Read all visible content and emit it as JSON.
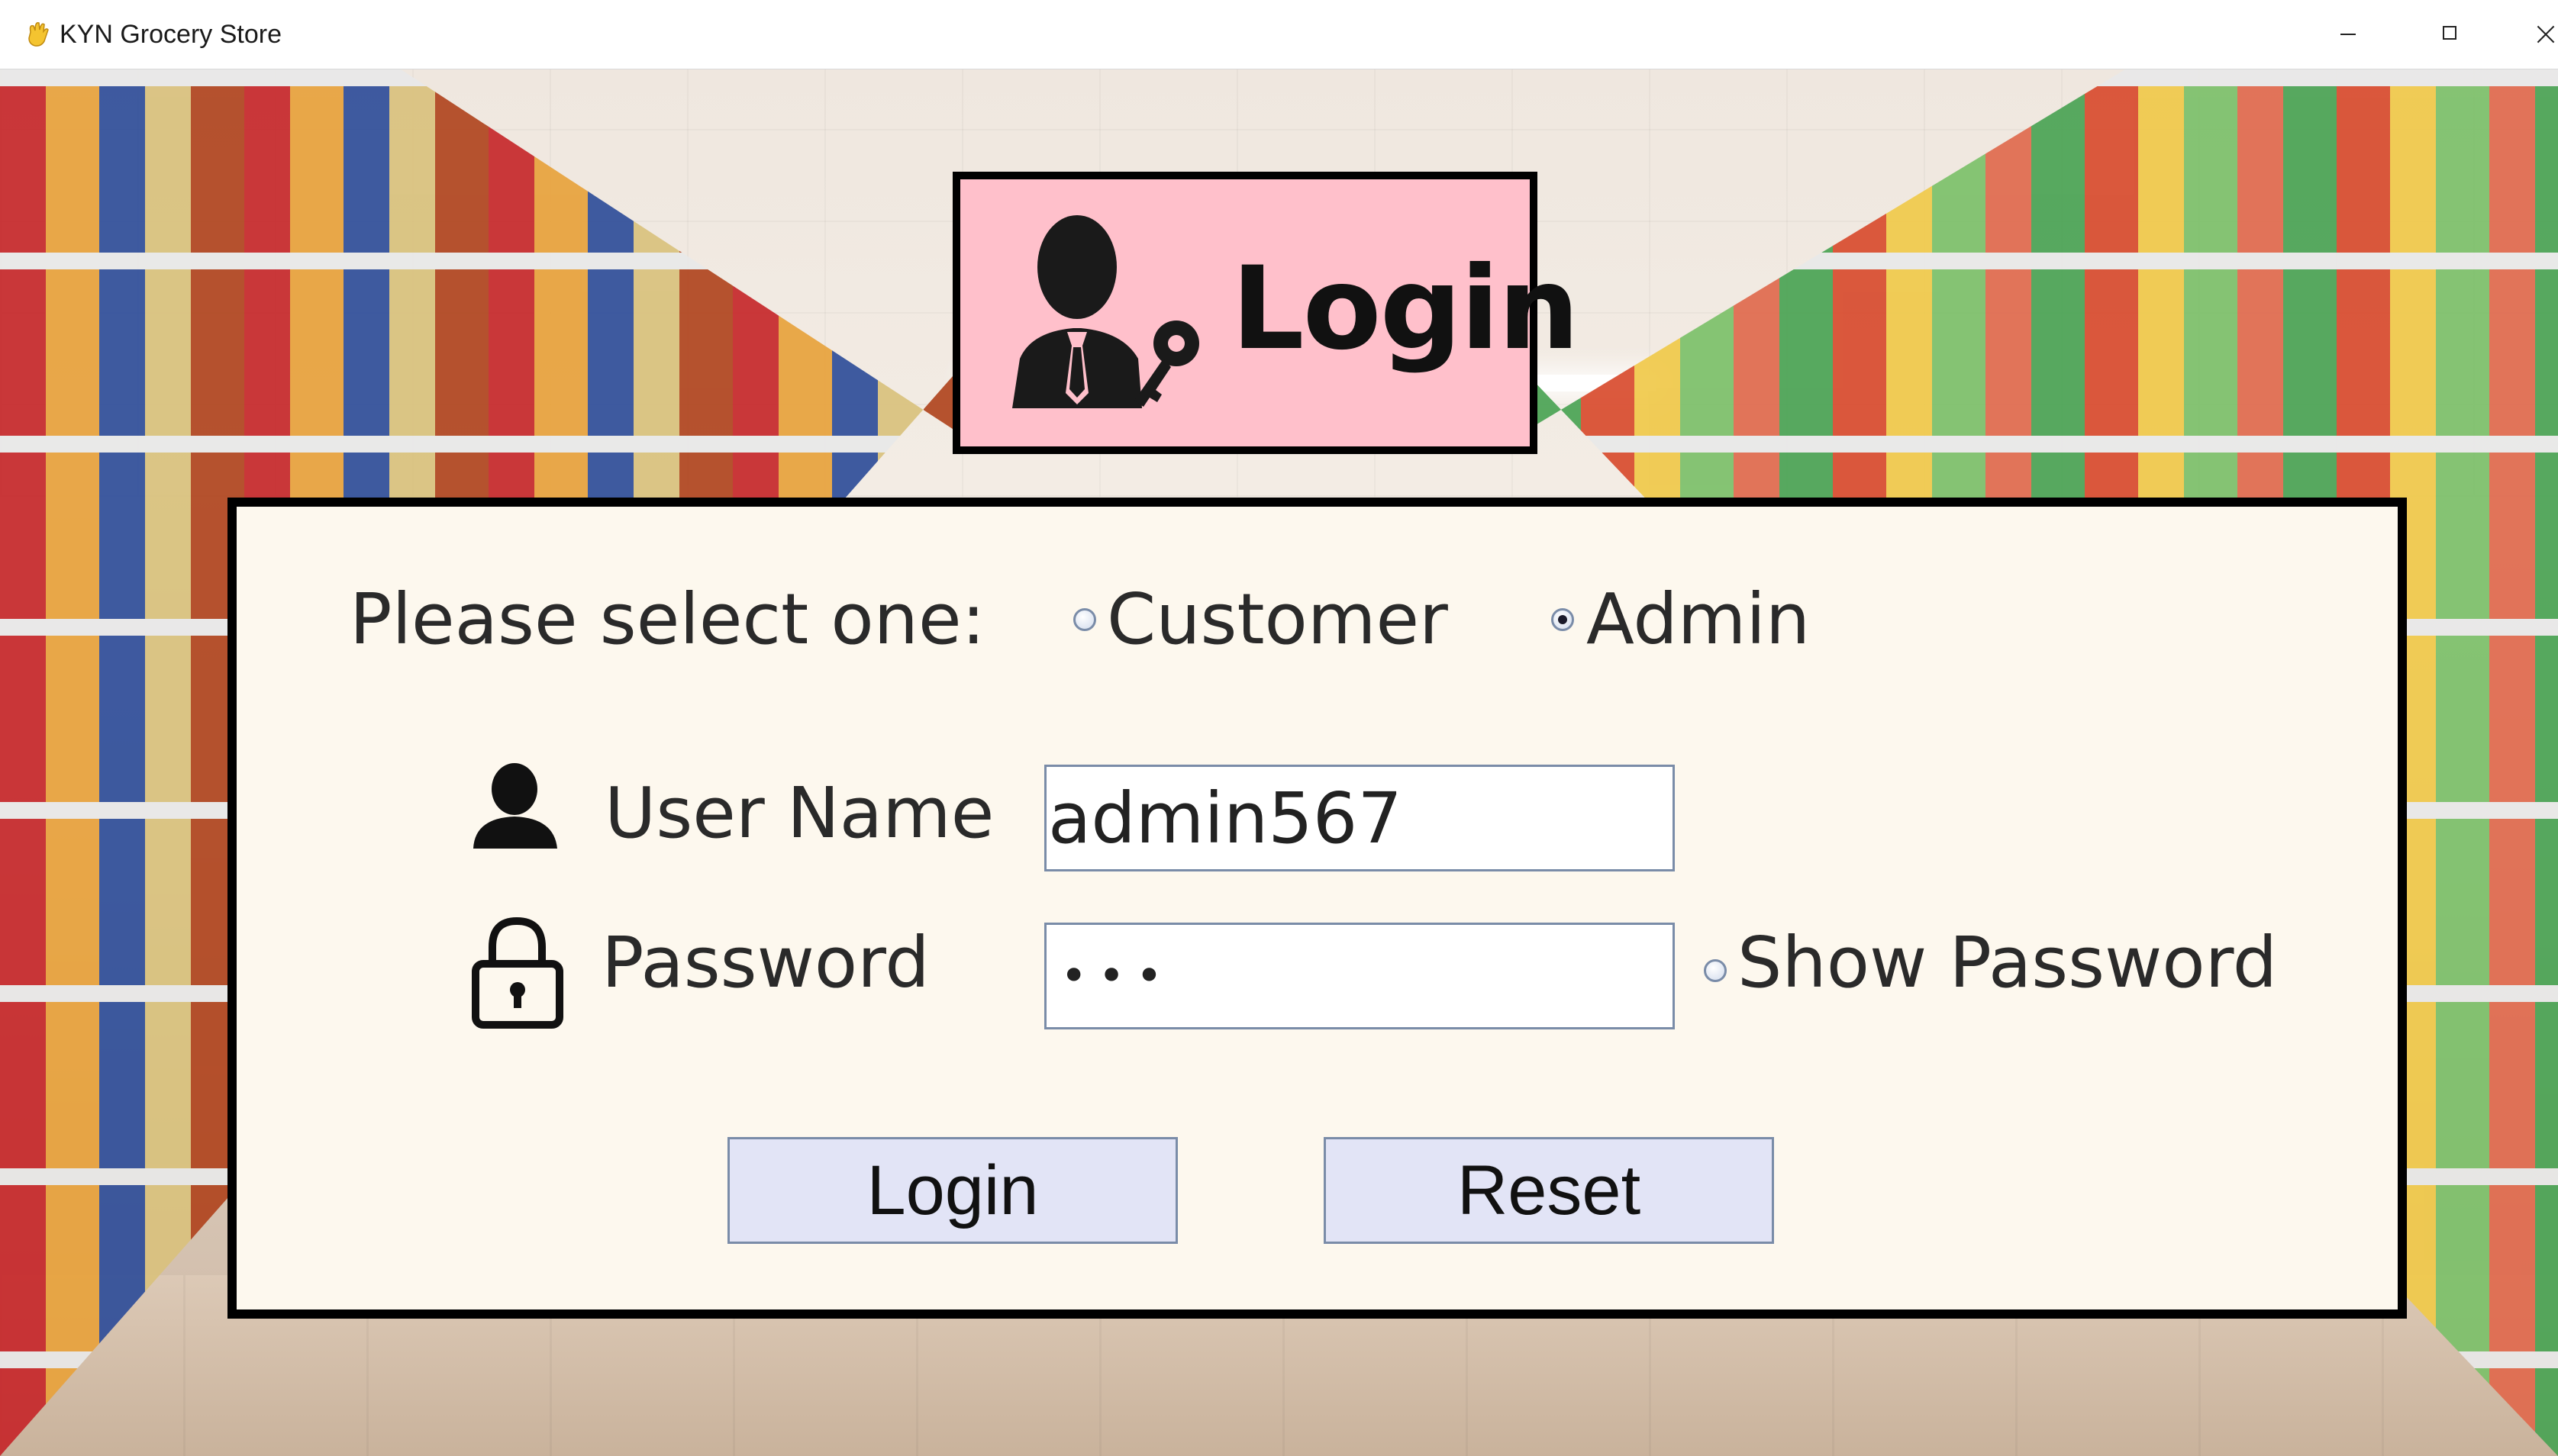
{
  "window": {
    "title": "KYN Grocery Store",
    "icon": "hand-emoji-icon"
  },
  "banner": {
    "title": "Login",
    "icon": "businessman-with-key-icon",
    "background": "#ffc0cb"
  },
  "form": {
    "prompt": "Please select one:",
    "role_options": [
      {
        "label": "Customer",
        "selected": false
      },
      {
        "label": "Admin",
        "selected": true
      }
    ],
    "username_label": "User Name",
    "username_value": "admin567",
    "password_label": "Password",
    "password_masked": "•••",
    "show_password_label": "Show Password",
    "show_password_checked": false,
    "login_button": "Login",
    "reset_button": "Reset",
    "colors": {
      "panel": "#fdf8ee",
      "button": "#e2e4f6",
      "border": "#000000"
    }
  }
}
